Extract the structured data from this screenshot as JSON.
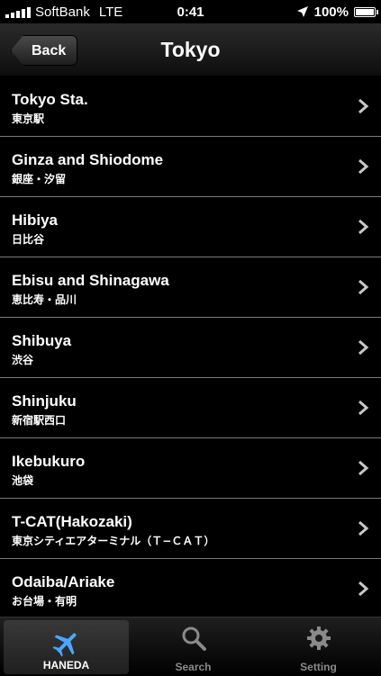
{
  "status": {
    "carrier": "SoftBank",
    "network": "LTE",
    "time": "0:41",
    "battery": "100%",
    "battery_level": 1.0
  },
  "nav": {
    "back_label": "Back",
    "title": "Tokyo"
  },
  "items": [
    {
      "en": "Tokyo Sta.",
      "ja": "東京駅"
    },
    {
      "en": "Ginza and Shiodome",
      "ja": "銀座・汐留"
    },
    {
      "en": "Hibiya",
      "ja": "日比谷"
    },
    {
      "en": "Ebisu and Shinagawa",
      "ja": "恵比寿・品川"
    },
    {
      "en": "Shibuya",
      "ja": "渋谷"
    },
    {
      "en": "Shinjuku",
      "ja": "新宿駅西口"
    },
    {
      "en": "Ikebukuro",
      "ja": "池袋"
    },
    {
      "en": "T-CAT(Hakozaki)",
      "ja": "東京シティエアターミナル（Ｔ−ＣＡＴ）"
    },
    {
      "en": "Odaiba/Ariake",
      "ja": "お台場・有明"
    }
  ],
  "tabs": [
    {
      "label": "HANEDA",
      "icon": "airplane-icon",
      "active": true
    },
    {
      "label": "Search",
      "icon": "search-icon",
      "active": false
    },
    {
      "label": "Setting",
      "icon": "gear-icon",
      "active": false
    }
  ],
  "colors": {
    "accent": "#4aa8ff",
    "chevron": "#c8c8c8",
    "separator": "#7a7a7a"
  }
}
